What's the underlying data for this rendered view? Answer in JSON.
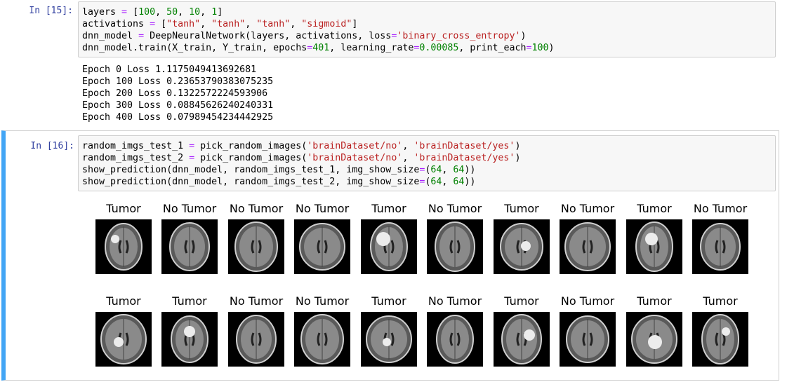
{
  "cell15": {
    "prompt": "In [15]:",
    "code": [
      [
        {
          "t": "layers ",
          "c": ""
        },
        {
          "t": "=",
          "c": "kw-op"
        },
        {
          "t": " [",
          "c": ""
        },
        {
          "t": "100",
          "c": "num"
        },
        {
          "t": ", ",
          "c": ""
        },
        {
          "t": "50",
          "c": "num"
        },
        {
          "t": ", ",
          "c": ""
        },
        {
          "t": "10",
          "c": "num"
        },
        {
          "t": ", ",
          "c": ""
        },
        {
          "t": "1",
          "c": "num"
        },
        {
          "t": "]",
          "c": ""
        }
      ],
      [
        {
          "t": "activations ",
          "c": ""
        },
        {
          "t": "=",
          "c": "kw-op"
        },
        {
          "t": " [",
          "c": ""
        },
        {
          "t": "\"tanh\"",
          "c": "str"
        },
        {
          "t": ", ",
          "c": ""
        },
        {
          "t": "\"tanh\"",
          "c": "str"
        },
        {
          "t": ", ",
          "c": ""
        },
        {
          "t": "\"tanh\"",
          "c": "str"
        },
        {
          "t": ", ",
          "c": ""
        },
        {
          "t": "\"sigmoid\"",
          "c": "str"
        },
        {
          "t": "]",
          "c": ""
        }
      ],
      [
        {
          "t": "dnn_model ",
          "c": ""
        },
        {
          "t": "=",
          "c": "kw-op"
        },
        {
          "t": " DeepNeuralNetwork(layers, activations, loss",
          "c": ""
        },
        {
          "t": "=",
          "c": "kw-op"
        },
        {
          "t": "'binary_cross_entropy'",
          "c": "str"
        },
        {
          "t": ")",
          "c": ""
        }
      ],
      [
        {
          "t": "dnn_model.train(X_train, Y_train, epochs",
          "c": ""
        },
        {
          "t": "=",
          "c": "kw-op"
        },
        {
          "t": "401",
          "c": "num"
        },
        {
          "t": ", learning_rate",
          "c": ""
        },
        {
          "t": "=",
          "c": "kw-op"
        },
        {
          "t": "0.00085",
          "c": "num"
        },
        {
          "t": ", print_each",
          "c": ""
        },
        {
          "t": "=",
          "c": "kw-op"
        },
        {
          "t": "100",
          "c": "num"
        },
        {
          "t": ")",
          "c": ""
        }
      ]
    ],
    "output": [
      "Epoch 0 Loss 1.1175049413692681",
      "Epoch 100 Loss 0.23653790383075235",
      "Epoch 200 Loss 0.1322572224593906",
      "Epoch 300 Loss 0.08845626240240331",
      "Epoch 400 Loss 0.07989454234442925"
    ]
  },
  "cell16": {
    "prompt": "In [16]:",
    "code": [
      [
        {
          "t": "random_imgs_test_1 ",
          "c": ""
        },
        {
          "t": "=",
          "c": "kw-op"
        },
        {
          "t": " pick_random_images(",
          "c": ""
        },
        {
          "t": "'brainDataset/no'",
          "c": "str"
        },
        {
          "t": ", ",
          "c": ""
        },
        {
          "t": "'brainDataset/yes'",
          "c": "str"
        },
        {
          "t": ")",
          "c": ""
        }
      ],
      [
        {
          "t": "random_imgs_test_2 ",
          "c": ""
        },
        {
          "t": "=",
          "c": "kw-op"
        },
        {
          "t": " pick_random_images(",
          "c": ""
        },
        {
          "t": "'brainDataset/no'",
          "c": "str"
        },
        {
          "t": ", ",
          "c": ""
        },
        {
          "t": "'brainDataset/yes'",
          "c": "str"
        },
        {
          "t": ")",
          "c": ""
        }
      ],
      [
        {
          "t": "show_prediction(dnn_model, random_imgs_test_1, img_show_size",
          "c": ""
        },
        {
          "t": "=",
          "c": "kw-op"
        },
        {
          "t": "(",
          "c": ""
        },
        {
          "t": "64",
          "c": "num"
        },
        {
          "t": ", ",
          "c": ""
        },
        {
          "t": "64",
          "c": "num"
        },
        {
          "t": "))",
          "c": ""
        }
      ],
      [
        {
          "t": "show_prediction(dnn_model, random_imgs_test_2, img_show_size",
          "c": ""
        },
        {
          "t": "=",
          "c": "kw-op"
        },
        {
          "t": "(",
          "c": ""
        },
        {
          "t": "64",
          "c": "num"
        },
        {
          "t": ", ",
          "c": ""
        },
        {
          "t": "64",
          "c": "num"
        },
        {
          "t": "))",
          "c": ""
        }
      ]
    ],
    "row1": [
      "Tumor",
      "No Tumor",
      "No Tumor",
      "No Tumor",
      "Tumor",
      "No Tumor",
      "Tumor",
      "No Tumor",
      "Tumor",
      "No Tumor"
    ],
    "row2": [
      "Tumor",
      "Tumor",
      "No Tumor",
      "No Tumor",
      "Tumor",
      "No Tumor",
      "Tumor",
      "No Tumor",
      "Tumor",
      "Tumor"
    ]
  }
}
